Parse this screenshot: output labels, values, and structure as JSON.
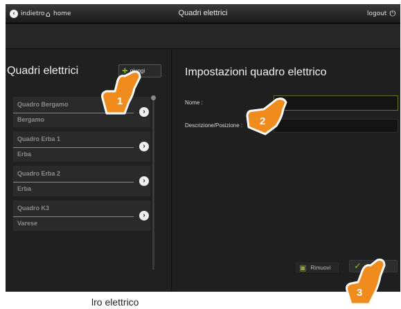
{
  "header": {
    "back_label": "indietro",
    "home_label": "home",
    "title": "Quadri elettrici",
    "logout_label": "logout"
  },
  "left_panel": {
    "title": "Quadri elettrici",
    "add_label": "giungi",
    "items": [
      {
        "name": "Quadro Bergamo",
        "location": "Bergamo"
      },
      {
        "name": "Quadro Erba 1",
        "location": "Erba"
      },
      {
        "name": "Quadro Erba 2",
        "location": "Erba"
      },
      {
        "name": "Quadro K3",
        "location": "Varese"
      }
    ]
  },
  "right_panel": {
    "title": "Impostazioni quadro elettrico",
    "name_label": "Nome :",
    "name_value": "",
    "description_label": "Descrizione/Posizione :",
    "description_value": "",
    "remove_label": "Rimuovi",
    "save_label": ""
  },
  "callouts": [
    "1",
    "2",
    "3"
  ],
  "caption": "lro elettrico",
  "colors": {
    "accent_green": "#7ec11e",
    "callout_orange": "#f08c1e"
  }
}
